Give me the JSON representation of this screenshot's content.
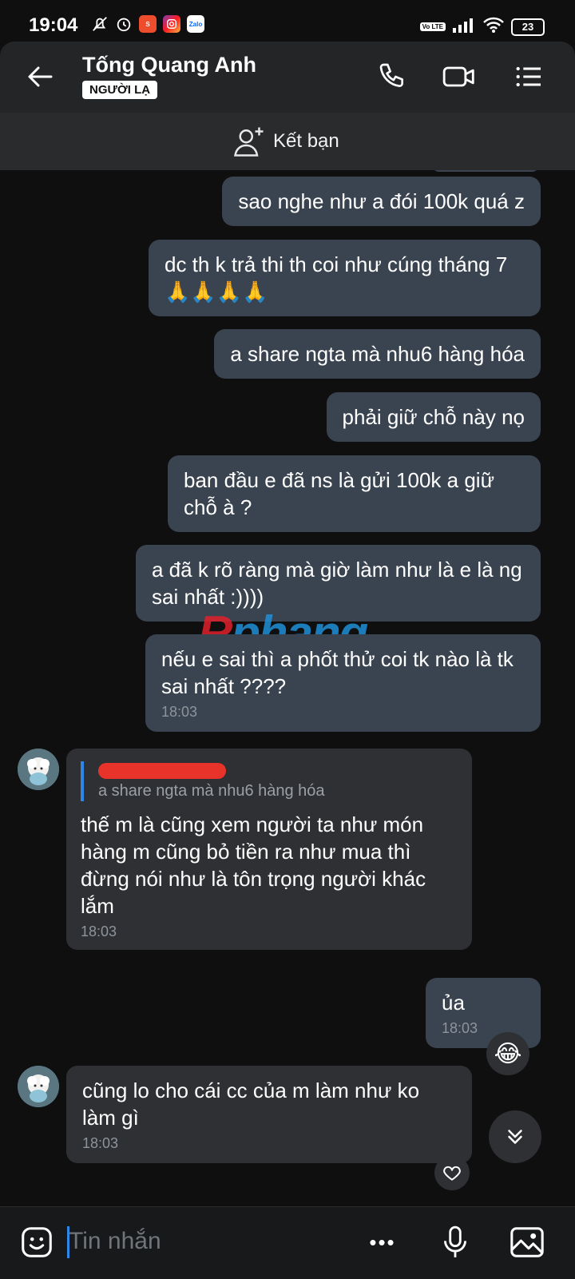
{
  "status_bar": {
    "time": "19:04",
    "battery": "23",
    "volte": "Vo LTE",
    "shopee_glyph": "S",
    "zalo_label": "Zalo"
  },
  "header": {
    "contact_name": "Tống Quang Anh",
    "badge": "NGƯỜI LẠ"
  },
  "friend_bar": {
    "label": "Kết bạn"
  },
  "messages_out": [
    {
      "text": "sao nghe như a đói 100k quá z"
    },
    {
      "text": "dc th k trả thi th coi như cúng tháng 7 🙏🙏🙏🙏"
    },
    {
      "text": "a share ngta mà nhu6 hàng hóa"
    },
    {
      "text": "phải giữ chỗ này nọ"
    },
    {
      "text": "ban đầu e đã ns là gửi 100k a giữ chỗ à ?"
    },
    {
      "text": "a đã k rõ ràng mà giờ làm như là e là ng sai nhất :))))"
    },
    {
      "text": "nếu e sai thì a phốt thử coi tk nào là tk sai nhất ????",
      "time": "18:03"
    }
  ],
  "reply_in": {
    "quote_text": "a share ngta mà nhu6 hàng hóa",
    "text": "thế m là cũng xem người ta như món hàng m cũng bỏ tiền ra như mua thì đừng nói như là tôn trọng người khác lắm",
    "time": "18:03"
  },
  "msg_ua": {
    "text": "ủa",
    "time": "18:03",
    "reaction": "😂"
  },
  "msg_last_in": {
    "text": "cũng lo cho cái cc của m làm như ko làm gì",
    "time": "18:03"
  },
  "watermark": {
    "part1": "R",
    "part2": "phang"
  },
  "composer": {
    "placeholder": "Tin nhắn",
    "more": "•••"
  }
}
